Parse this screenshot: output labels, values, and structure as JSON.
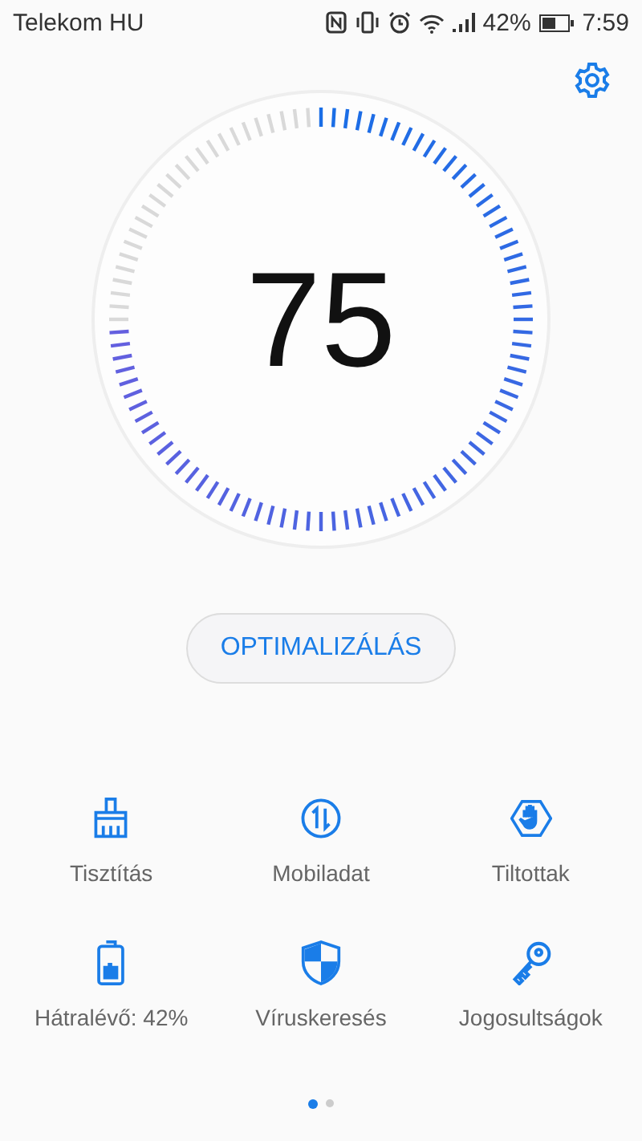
{
  "status_bar": {
    "carrier": "Telekom HU",
    "battery_percent": "42%",
    "time": "7:59"
  },
  "score": {
    "value": "75"
  },
  "optimize_button": {
    "label": "OPTIMALIZÁLÁS"
  },
  "tools": [
    {
      "kind": "broom",
      "label": "Tisztítás"
    },
    {
      "kind": "data",
      "label": "Mobiladat"
    },
    {
      "kind": "block",
      "label": "Tiltottak"
    },
    {
      "kind": "battery",
      "label": "Hátralévő: 42%"
    },
    {
      "kind": "shield",
      "label": "Víruskeresés"
    },
    {
      "kind": "key",
      "label": "Jogosultságok"
    }
  ],
  "pages": [
    {
      "selected": true
    },
    {
      "selected": false
    }
  ]
}
